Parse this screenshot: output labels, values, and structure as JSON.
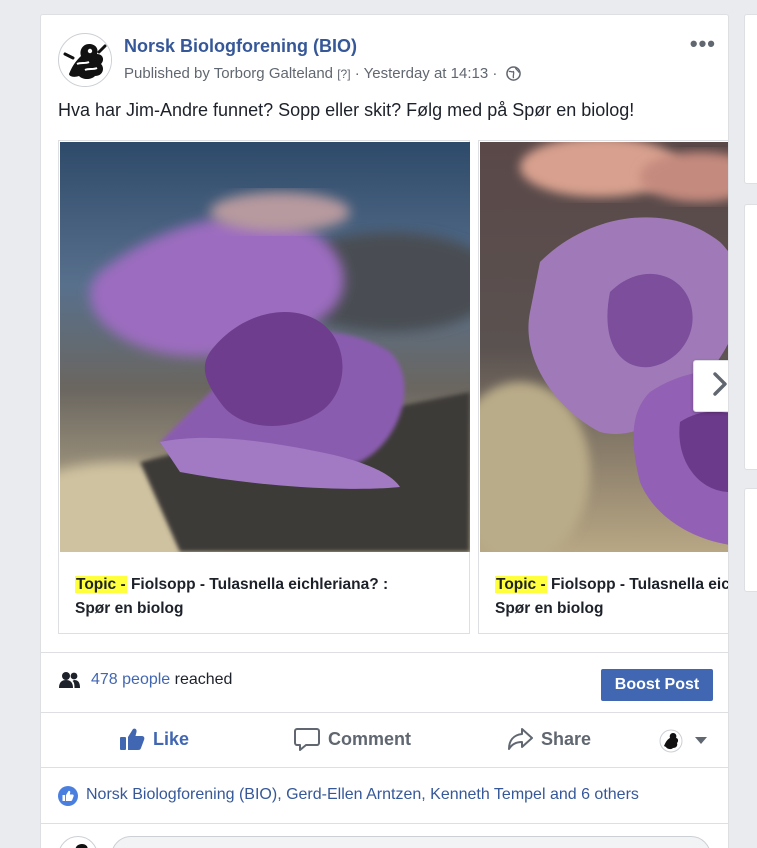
{
  "post": {
    "page_name": "Norsk Biologforening (BIO)",
    "published_by": "Published by Torborg Galteland",
    "help_marker": "[?]",
    "separator": "·",
    "timestamp": "Yesterday at 14:13",
    "more_label": "•••",
    "text": "Hva har Jim-Andre funnet? Sopp eller skit? Følg med på Spør en biolog!"
  },
  "carousel": {
    "cards": [
      {
        "topic": "Topic -",
        "title": " Fiolsopp - Tulasnella eichleriana? :",
        "subtitle": "Spør en biolog"
      },
      {
        "topic": "Topic -",
        "title": " Fiolsopp - Tulasnella eichleriana? :",
        "subtitle": "Spør en biolog"
      }
    ]
  },
  "reach": {
    "count_label": "478 people",
    "suffix": " reached",
    "boost_label": "Boost Post"
  },
  "actions": {
    "like": "Like",
    "comment": "Comment",
    "share": "Share"
  },
  "reactions": {
    "text": "Norsk Biologforening (BIO), Gerd-Ellen Arntzen, Kenneth Tempel and 6 others"
  },
  "colors": {
    "brand_blue": "#4267b2",
    "link_blue": "#365899",
    "highlight": "#ffff3c"
  }
}
